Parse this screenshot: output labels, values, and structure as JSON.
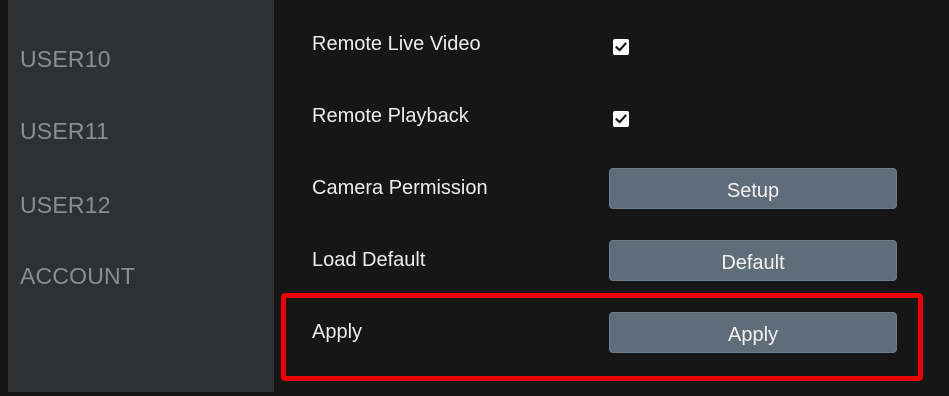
{
  "sidebar": {
    "items": [
      {
        "label": "USER10"
      },
      {
        "label": "USER11"
      },
      {
        "label": "USER12"
      },
      {
        "label": "ACCOUNT"
      }
    ]
  },
  "settings": {
    "remote_live_video": {
      "label": "Remote Live Video",
      "checked": true
    },
    "remote_playback": {
      "label": "Remote Playback",
      "checked": true
    },
    "camera_permission": {
      "label": "Camera Permission",
      "button": "Setup"
    },
    "load_default": {
      "label": "Load Default",
      "button": "Default"
    },
    "apply": {
      "label": "Apply",
      "button": "Apply"
    }
  },
  "colors": {
    "highlight": "#ee0000",
    "button_bg": "#5f6c79",
    "sidebar_bg": "#2f3033",
    "main_bg": "#161616"
  }
}
